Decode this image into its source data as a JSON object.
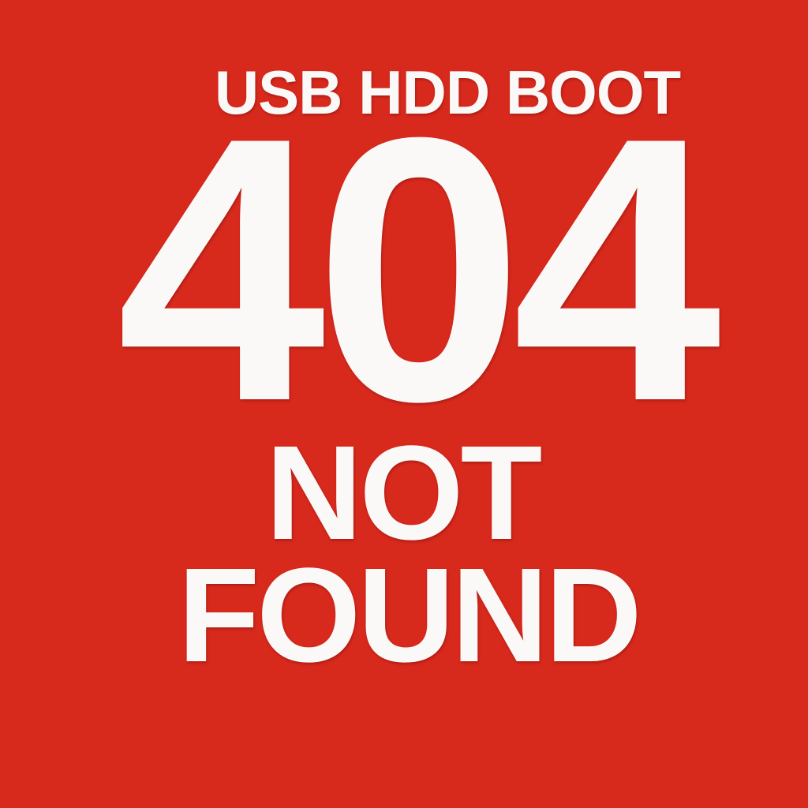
{
  "screen": {
    "background_color": "#d8291d",
    "text_color": "#fbf9f7"
  },
  "boot": {
    "device_label": "USB HDD BOOT"
  },
  "error": {
    "code": "404",
    "message_line_1": "NOT",
    "message_line_2": "FOUND"
  }
}
